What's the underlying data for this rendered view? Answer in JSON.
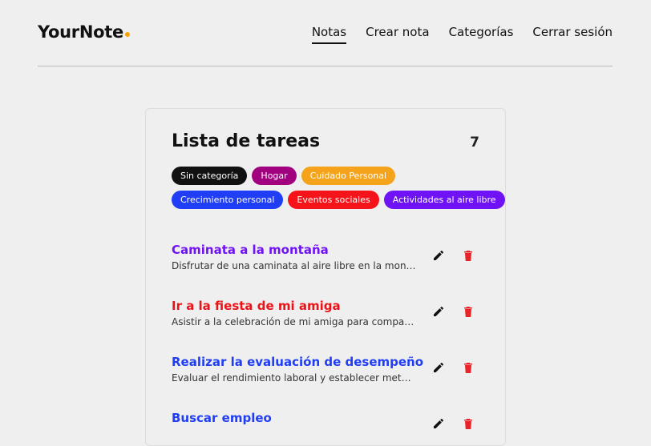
{
  "header": {
    "logo": "YourNote",
    "logo_dot_color": "#f5a300",
    "nav": [
      {
        "label": "Notas",
        "active": true
      },
      {
        "label": "Crear nota",
        "active": false
      },
      {
        "label": "Categorías",
        "active": false
      },
      {
        "label": "Cerrar sesión",
        "active": false
      }
    ]
  },
  "card": {
    "title": "Lista de tareas",
    "count": "7",
    "categories": [
      {
        "label": "Sin categoría",
        "color": "#111111"
      },
      {
        "label": "Hogar",
        "color": "#a1007f"
      },
      {
        "label": "Cuidado Personal",
        "color": "#f5a31a"
      },
      {
        "label": "Crecimiento personal",
        "color": "#1f3ef5"
      },
      {
        "label": "Eventos sociales",
        "color": "#f5141a"
      },
      {
        "label": "Actividades al aire libre",
        "color": "#6f12f5"
      }
    ],
    "tasks": [
      {
        "title": "Caminata a la montaña",
        "desc": "Disfrutar de una caminata al aire libre en la montaña",
        "color": "#6f12f5",
        "edit_icon": "pencil-icon",
        "delete_icon": "trash-icon"
      },
      {
        "title": "Ir a la fiesta de mi amiga",
        "desc": "Asistir a la celebración de mi amiga para compartir juntos",
        "color": "#e8141a",
        "edit_icon": "pencil-icon",
        "delete_icon": "trash-icon"
      },
      {
        "title": "Realizar la evaluación de desempeño",
        "desc": "Evaluar el rendimiento laboral y establecer metas para el año",
        "color": "#1f3ef5",
        "edit_icon": "pencil-icon",
        "delete_icon": "trash-icon"
      },
      {
        "title": "Buscar empleo",
        "desc": "",
        "color": "#1f3ef5",
        "edit_icon": "pencil-icon",
        "delete_icon": "trash-icon"
      }
    ]
  }
}
